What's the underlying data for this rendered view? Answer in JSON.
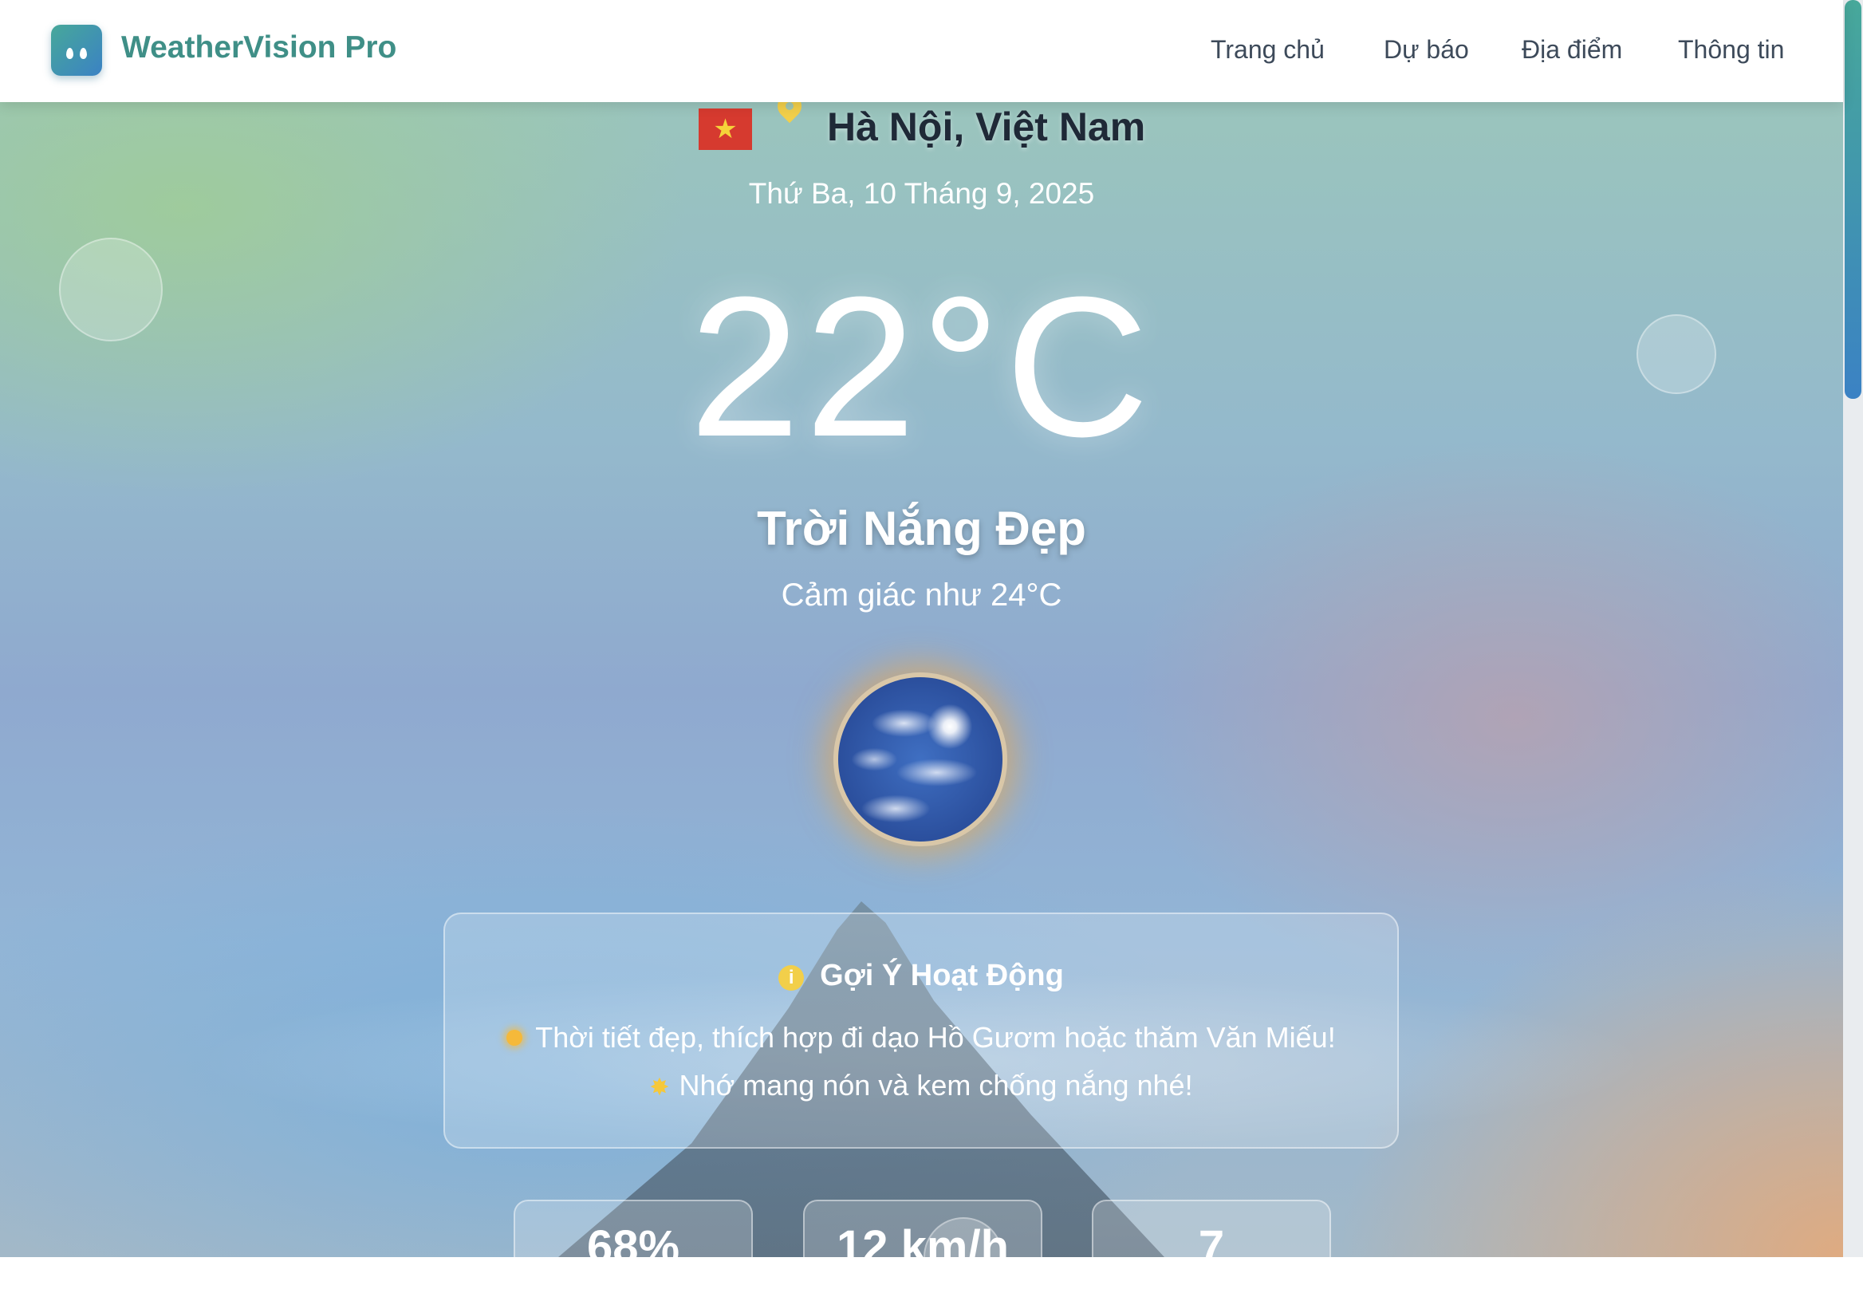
{
  "nav": {
    "brand": "WeatherVision Pro",
    "links": [
      {
        "label": "Trang chủ"
      },
      {
        "label": "Dự báo"
      },
      {
        "label": "Địa điểm"
      },
      {
        "label": "Thông tin"
      }
    ]
  },
  "location": {
    "flag_icon": "vietnam-flag-icon",
    "pin_icon": "map-pin-icon",
    "name": "Hà Nội, Việt Nam",
    "date": "Thứ Ba, 10 Tháng 9, 2025"
  },
  "current": {
    "temperature": "22°C",
    "condition": "Trời Nắng Đẹp",
    "feels_like": "Cảm giác như 24°C",
    "weather_image": "sunny-sky-globe"
  },
  "suggestion": {
    "icon": "info-icon",
    "title": "Gợi Ý Hoạt Động",
    "lines": [
      "Thời tiết đẹp, thích hợp đi dạo Hồ Gươm hoặc thăm Văn Miếu!",
      "Nhớ mang nón và kem chống nắng nhé!"
    ]
  },
  "stats": [
    {
      "value": "68%"
    },
    {
      "value": "12 km/h"
    },
    {
      "value": "7"
    }
  ],
  "colors": {
    "brand": "#3f8f87",
    "accent_gradient_start": "#47a89a",
    "accent_gradient_end": "#3b82c4",
    "pin": "#f2cf4a",
    "flag_red": "#d63a2f"
  }
}
